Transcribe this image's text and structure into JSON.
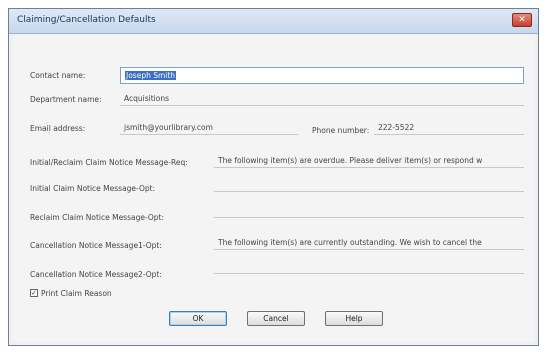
{
  "window": {
    "title": "Claiming/Cancellation Defaults",
    "close_glyph": "✕"
  },
  "form": {
    "contact_name_label": "Contact name:",
    "contact_name_value": "Joseph Smith",
    "department_label": "Department name:",
    "department_value": "Acquisitions",
    "email_label": "Email address:",
    "email_value": "jsmith@yourlibrary.com",
    "phone_label": "Phone number:",
    "phone_value": "222-5522",
    "msg_initial_reclaim_req_label": "Initial/Reclaim Claim Notice Message-Req:",
    "msg_initial_reclaim_req_value": "The following item(s) are overdue. Please deliver item(s) or respond w",
    "msg_initial_opt_label": "Initial Claim Notice Message-Opt:",
    "msg_initial_opt_value": "",
    "msg_reclaim_opt_label": "Reclaim Claim Notice Message-Opt:",
    "msg_reclaim_opt_value": "",
    "msg_cancel1_opt_label": "Cancellation Notice Message1-Opt:",
    "msg_cancel1_opt_value": "The following item(s) are currently outstanding. We wish to cancel the",
    "msg_cancel2_opt_label": "Cancellation Notice Message2-Opt:",
    "msg_cancel2_opt_value": "",
    "print_reason_label": "Print Claim Reason",
    "print_reason_checked_glyph": "✓"
  },
  "buttons": {
    "ok": "OK",
    "cancel": "Cancel",
    "help": "Help"
  }
}
